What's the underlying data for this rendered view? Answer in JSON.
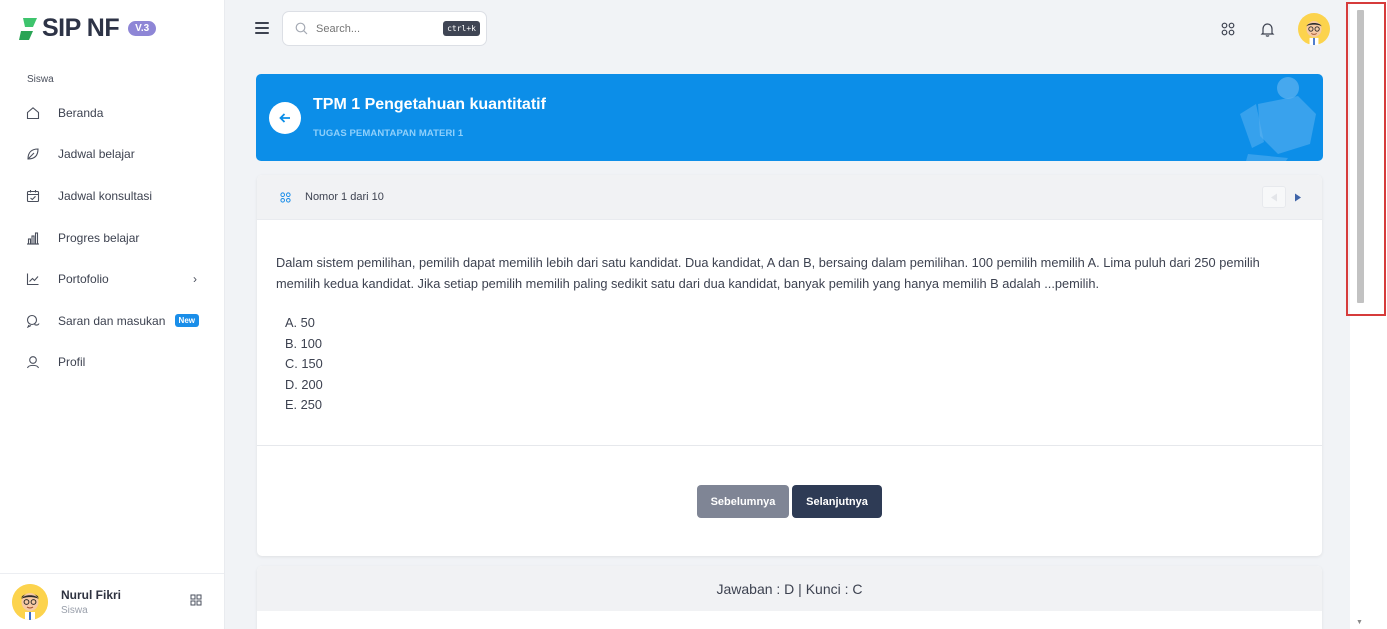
{
  "app": {
    "name": "SIP NF",
    "version": "V.3"
  },
  "sidebar": {
    "section_label": "Siswa",
    "items": [
      {
        "label": "Beranda",
        "icon": "home-icon"
      },
      {
        "label": "Jadwal belajar",
        "icon": "leaf-icon"
      },
      {
        "label": "Jadwal konsultasi",
        "icon": "calendar-check-icon"
      },
      {
        "label": "Progres belajar",
        "icon": "bar-chart-icon"
      },
      {
        "label": "Portofolio",
        "icon": "trending-chart-icon",
        "has_submenu": true
      },
      {
        "label": "Saran dan masukan",
        "icon": "chat-icon",
        "badge": "New"
      },
      {
        "label": "Profil",
        "icon": "user-icon"
      }
    ],
    "user": {
      "name": "Nurul Fikri",
      "role": "Siswa"
    }
  },
  "topbar": {
    "search_placeholder": "Search...",
    "search_shortcut": "ctrl+k"
  },
  "banner": {
    "title": "TPM 1 Pengetahuan kuantitatif",
    "subtitle": "TUGAS PEMANTAPAN MATERI 1"
  },
  "question": {
    "counter": "Nomor 1 dari 10",
    "text": "Dalam sistem pemilihan, pemilih dapat memilih lebih dari satu kandidat. Dua kandidat, A dan B, bersaing dalam pemilihan. 100 pemilih memilih A. Lima puluh dari 250 pemilih memilih kedua kandidat. Jika setiap pemilih memilih paling sedikit satu dari dua kandidat, banyak pemilih yang hanya memilih B adalah ...pemilih.",
    "options": [
      "A. 50",
      "B. 100",
      "C. 150",
      "D. 200",
      "E. 250"
    ],
    "prev_label": "Sebelumnya",
    "next_label": "Selanjutnya"
  },
  "answer": {
    "summary": "Jawaban : D | Kunci : C"
  },
  "colors": {
    "primary": "#0c8ee8",
    "dark_button": "#2e3b55",
    "muted_button": "#7f8595",
    "badge_new": "#1a8ee9",
    "highlight": "#d63b3b"
  }
}
